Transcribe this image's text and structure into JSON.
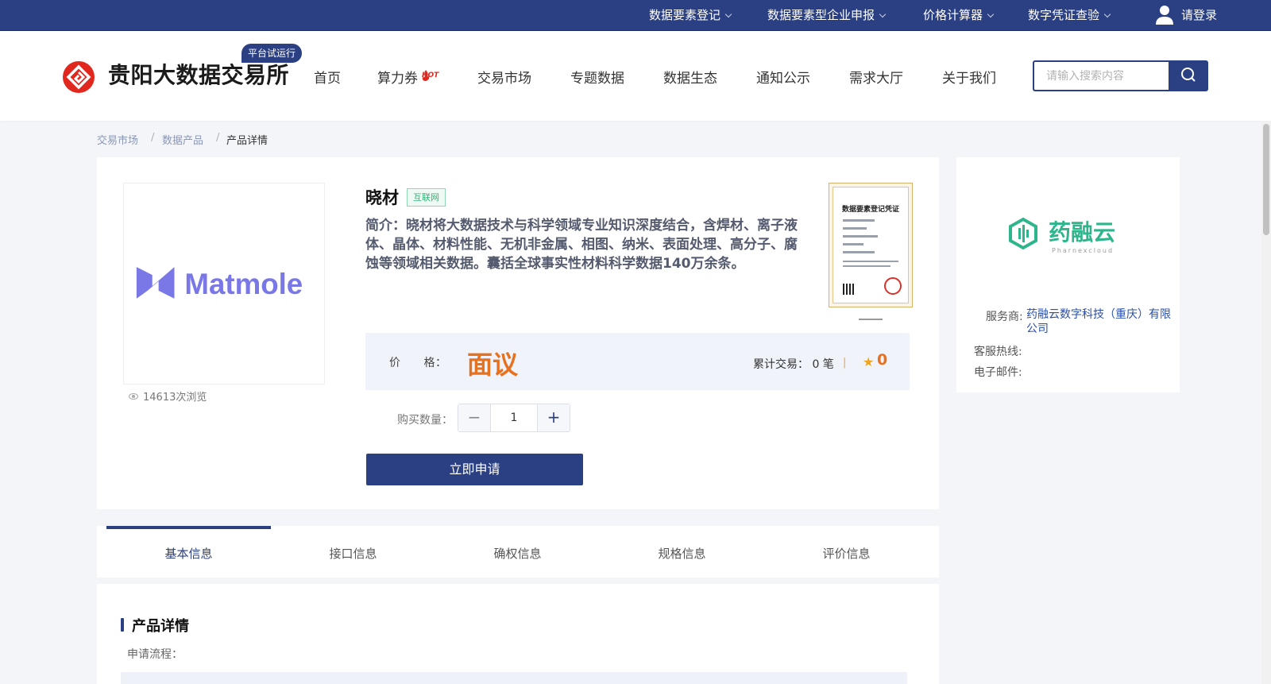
{
  "topbar": {
    "links": [
      {
        "label": "数据要素登记"
      },
      {
        "label": "数据要素型企业申报"
      },
      {
        "label": "价格计算器"
      },
      {
        "label": "数字凭证查验"
      }
    ],
    "login_label": "请登录"
  },
  "header": {
    "site_name": "贵阳大数据交易所",
    "badge": "平台试运行",
    "nav": [
      {
        "label": "首页"
      },
      {
        "label": "算力券"
      },
      {
        "label": "交易市场"
      },
      {
        "label": "专题数据"
      },
      {
        "label": "数据生态"
      },
      {
        "label": "通知公示"
      },
      {
        "label": "需求大厅"
      },
      {
        "label": "关于我们"
      }
    ],
    "hot_tag": "HOT",
    "search_placeholder": "请输入搜索内容"
  },
  "breadcrumb": [
    "交易市场",
    "数据产品",
    "产品详情"
  ],
  "product": {
    "logo_text": "Matmole",
    "views": "14613次浏览",
    "title": "晓材",
    "tag": "互联网",
    "description": "简介：晓材将大数据技术与科学领域专业知识深度结合，含焊材、离子液体、晶体、材料性能、无机非金属、相图、纳米、表面处理、高分子、腐蚀等领域相关数据。囊括全球事实性材料科学数据140万余条。",
    "certificate_title": "数据要素登记凭证",
    "price_label": "价　　格：",
    "price_value": "面议",
    "trade_count": "累计交易： 0 笔",
    "rating": "0",
    "qty_label": "购买数量：",
    "qty_value": "1",
    "apply_label": "立即申请"
  },
  "tabs": [
    {
      "label": "基本信息",
      "active": true
    },
    {
      "label": "接口信息"
    },
    {
      "label": "确权信息"
    },
    {
      "label": "规格信息"
    },
    {
      "label": "评价信息"
    }
  ],
  "detail": {
    "title": "产品详情",
    "subtitle": "申请流程："
  },
  "provider": {
    "logo_cn": "药融云",
    "logo_en": "Pharnexcloud",
    "service_label": "服务商:",
    "service_name": "药融云数字科技（重庆）有限公司",
    "hotline_label": "客服热线:",
    "email_label": "电子邮件:"
  },
  "colors": {
    "brand": "#2b3f83",
    "price": "#e6711f",
    "logo_red": "#e0281f",
    "provider_green": "#2fb58c"
  }
}
